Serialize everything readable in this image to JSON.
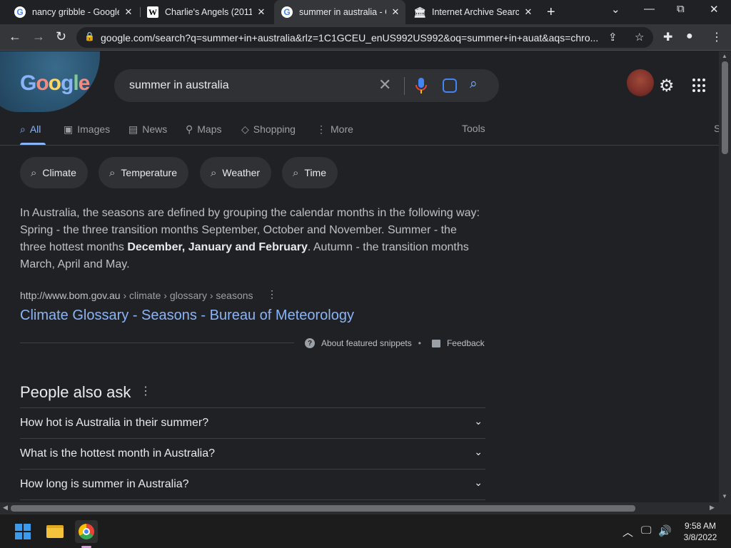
{
  "browser": {
    "tabs": [
      {
        "title": "nancy gribble - Google",
        "favicon": "G",
        "active": false
      },
      {
        "title": "Charlie's Angels (2011",
        "favicon": "W",
        "active": false
      },
      {
        "title": "summer in australia - G",
        "favicon": "G",
        "active": true
      },
      {
        "title": "Internet Archive Search",
        "favicon": "museum",
        "active": false
      }
    ],
    "new_tab": "+",
    "window_controls": {
      "tab_search": "⌄",
      "minimize": "—",
      "restore": "⧉",
      "close": "✕"
    },
    "url": "google.com/search?q=summer+in+australia&rlz=1C1GCEU_enUS992US992&oq=summer+in+auat&aqs=chro..."
  },
  "google": {
    "logo_letters": [
      "G",
      "o",
      "o",
      "g",
      "l",
      "e"
    ],
    "search_query": "summer in australia",
    "tabs": [
      {
        "label": "All",
        "icon": "search-icon",
        "active": true
      },
      {
        "label": "Images",
        "icon": "image-icon",
        "active": false
      },
      {
        "label": "News",
        "icon": "news-icon",
        "active": false
      },
      {
        "label": "Maps",
        "icon": "pin-icon",
        "active": false
      },
      {
        "label": "Shopping",
        "icon": "tag-icon",
        "active": false
      },
      {
        "label": "More",
        "icon": "more-vert-icon",
        "active": false
      }
    ],
    "tools_label": "Tools",
    "cut_off_text": "S",
    "chips": [
      "Climate",
      "Temperature",
      "Weather",
      "Time"
    ],
    "snippet": {
      "part1": "In Australia, the seasons are defined by grouping the calendar months in the following way: Spring - the three transition months September, October and November. Summer - the three hottest months ",
      "bold": "December, January and February",
      "part2": ". Autumn - the transition months March, April and May."
    },
    "cite": {
      "domain": "http://www.bom.gov.au",
      "path": " › climate › glossary › seasons"
    },
    "result_title": "Climate Glossary - Seasons - Bureau of Meteorology",
    "about_snippets": "About featured snippets",
    "feedback": "Feedback",
    "people_also_ask": {
      "title": "People also ask",
      "questions": [
        "How hot is Australia in their summer?",
        "What is the hottest month in Australia?",
        "How long is summer in Australia?"
      ]
    }
  },
  "taskbar": {
    "time": "9:58 AM",
    "date": "3/8/2022"
  },
  "colors": {
    "background": "#202124",
    "link": "#8ab4f8",
    "chip": "#303134",
    "text": "#e8eaed",
    "muted": "#bdc1c6"
  }
}
